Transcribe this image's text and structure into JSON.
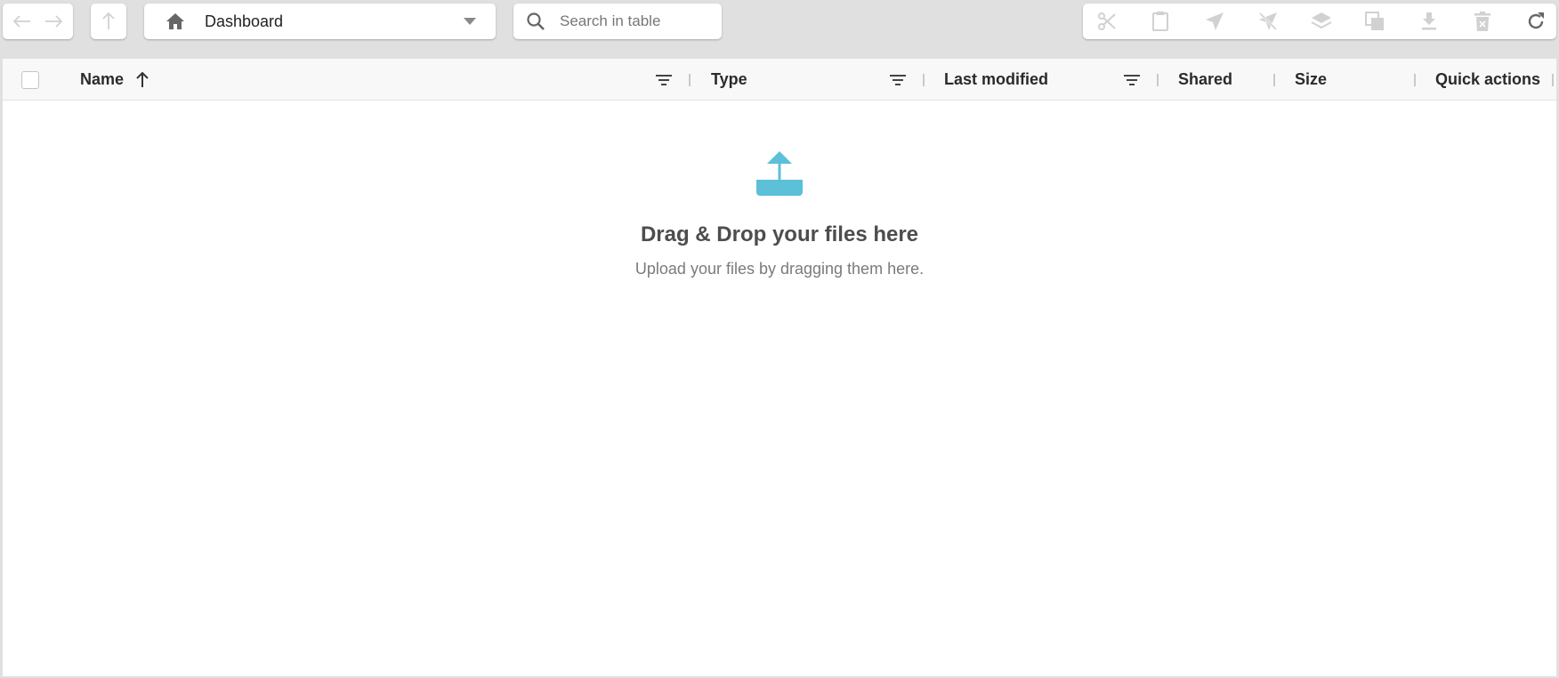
{
  "toolbar": {
    "nav": {
      "back_icon": "arrow-left-icon",
      "forward_icon": "arrow-right-icon",
      "up_icon": "arrow-up-icon"
    },
    "path": {
      "home_icon": "home-icon",
      "label": "Dashboard",
      "dropdown_icon": "caret-down-icon"
    },
    "search": {
      "icon": "search-icon",
      "placeholder": "Search in table"
    },
    "actions": [
      {
        "name": "cut-icon",
        "enabled": false
      },
      {
        "name": "clipboard-icon",
        "enabled": false
      },
      {
        "name": "share-icon",
        "enabled": false
      },
      {
        "name": "unshare-icon",
        "enabled": false
      },
      {
        "name": "layers-icon",
        "enabled": false
      },
      {
        "name": "copy-icon",
        "enabled": false
      },
      {
        "name": "download-icon",
        "enabled": false
      },
      {
        "name": "delete-icon",
        "enabled": false
      },
      {
        "name": "refresh-icon",
        "enabled": true
      }
    ]
  },
  "table": {
    "columns": {
      "name": "Name",
      "type": "Type",
      "last_modified": "Last modified",
      "shared": "Shared",
      "size": "Size",
      "quick_actions": "Quick actions"
    },
    "sort": {
      "column": "Name",
      "direction": "ascending"
    }
  },
  "empty_state": {
    "icon": "upload-icon",
    "title": "Drag & Drop your files here",
    "subtitle": "Upload your files by dragging them here."
  },
  "colors": {
    "accent": "#5bc0d8",
    "background": "#e0e0e0",
    "disabled_icon": "#9e9e9e"
  }
}
